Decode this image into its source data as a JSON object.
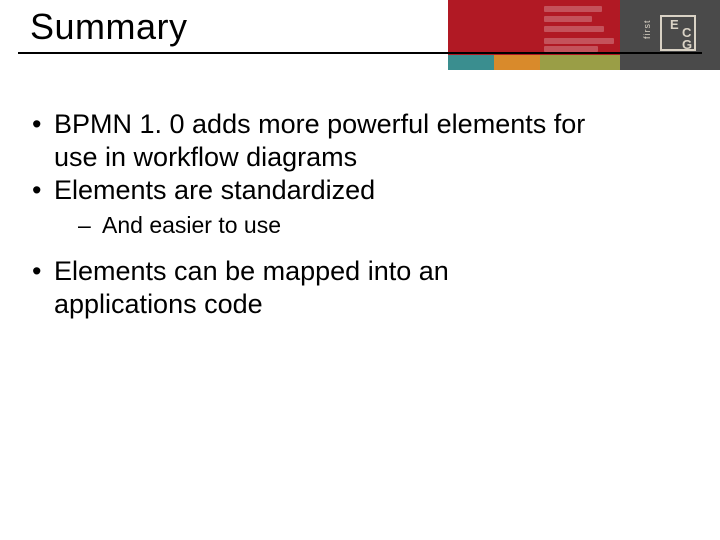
{
  "title": "Summary",
  "bullets": {
    "b1": "BPMN 1. 0 adds more powerful elements for use in workflow diagrams",
    "b2": "Elements are standardized",
    "b2_sub1": "And easier to use",
    "b3": "Elements can be mapped into an applications code"
  },
  "logo": {
    "letters": {
      "e": "E",
      "c": "C",
      "g": "G"
    },
    "word": "first"
  }
}
